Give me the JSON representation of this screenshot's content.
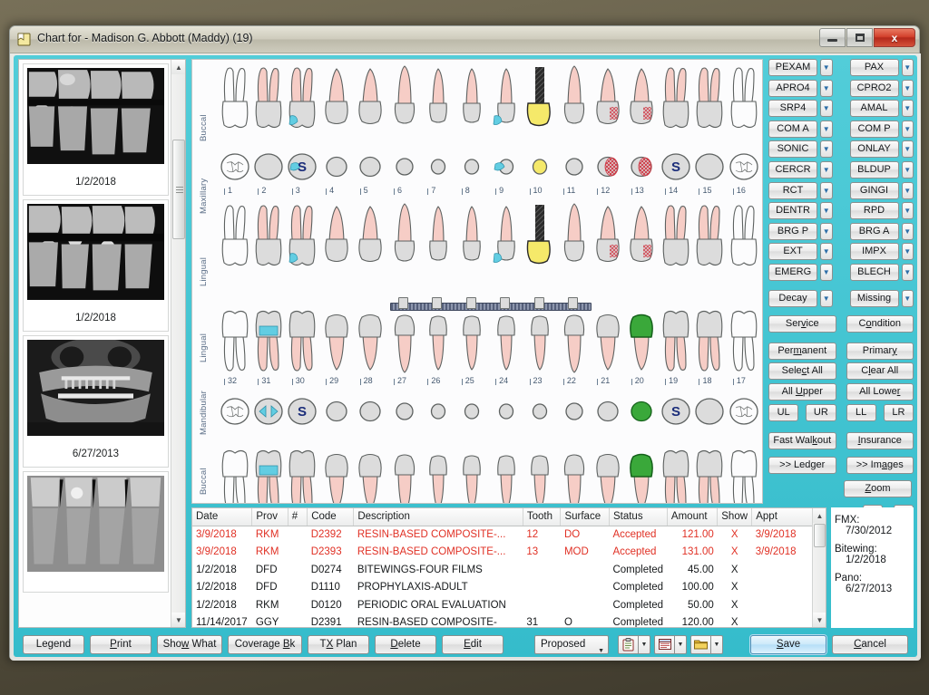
{
  "window": {
    "title": "Chart for - Madison G. Abbott (Maddy) (19)",
    "icon": "chart-book-icon",
    "minimize_label": "Minimize",
    "maximize_label": "Maximize",
    "close_label": "x"
  },
  "images_panel": {
    "thumbnails": [
      {
        "caption": "1/2/2018",
        "kind": "bitewing-xray"
      },
      {
        "caption": "1/2/2018",
        "kind": "bitewing-xray"
      },
      {
        "caption": "6/27/2013",
        "kind": "panoramic-xray"
      },
      {
        "caption": "",
        "kind": "periapical-xray"
      }
    ]
  },
  "chart": {
    "arch_labels": {
      "maxillary_buccal": "Buccal",
      "maxillary": "Maxillary",
      "maxillary_lingual": "Lingual",
      "mandibular_lingual": "Lingual",
      "mandibular": "Mandibular",
      "mandibular_buccal": "Buccal"
    },
    "upper_numbers": [
      "1",
      "2",
      "3",
      "4",
      "5",
      "6",
      "7",
      "8",
      "9",
      "10",
      "11",
      "12",
      "13",
      "14",
      "15",
      "16"
    ],
    "lower_numbers": [
      "32",
      "31",
      "30",
      "29",
      "28",
      "27",
      "26",
      "25",
      "24",
      "23",
      "22",
      "21",
      "20",
      "19",
      "18",
      "17"
    ],
    "upper_teeth": [
      {
        "num": "1",
        "type": "molar",
        "present": false,
        "root_color": "none",
        "marks": []
      },
      {
        "num": "2",
        "type": "molar",
        "present": true,
        "root_color": "pink",
        "marks": []
      },
      {
        "num": "3",
        "type": "molar",
        "present": true,
        "root_color": "pink",
        "marks": [
          "sealant",
          "watch-blue"
        ]
      },
      {
        "num": "4",
        "type": "premolar",
        "present": true,
        "root_color": "pink",
        "marks": []
      },
      {
        "num": "5",
        "type": "premolar",
        "present": true,
        "root_color": "pink",
        "marks": []
      },
      {
        "num": "6",
        "type": "canine",
        "present": true,
        "root_color": "pink",
        "marks": []
      },
      {
        "num": "7",
        "type": "incisor",
        "present": true,
        "root_color": "pink",
        "marks": []
      },
      {
        "num": "8",
        "type": "incisor",
        "present": true,
        "root_color": "pink",
        "marks": []
      },
      {
        "num": "9",
        "type": "incisor",
        "present": true,
        "root_color": "pink",
        "marks": [
          "watch-blue"
        ]
      },
      {
        "num": "10",
        "type": "incisor",
        "present": true,
        "root_color": "post",
        "marks": [
          "crown-gold",
          "post"
        ]
      },
      {
        "num": "11",
        "type": "canine",
        "present": true,
        "root_color": "pink",
        "marks": []
      },
      {
        "num": "12",
        "type": "premolar",
        "present": true,
        "root_color": "pink",
        "marks": [
          "decay-red"
        ]
      },
      {
        "num": "13",
        "type": "premolar",
        "present": true,
        "root_color": "pink",
        "marks": [
          "decay-red"
        ]
      },
      {
        "num": "14",
        "type": "molar",
        "present": true,
        "root_color": "pink",
        "marks": [
          "sealant"
        ]
      },
      {
        "num": "15",
        "type": "molar",
        "present": true,
        "root_color": "pink",
        "marks": []
      },
      {
        "num": "16",
        "type": "molar",
        "present": false,
        "root_color": "none",
        "marks": []
      }
    ],
    "lower_teeth": [
      {
        "num": "32",
        "type": "molar",
        "present": false,
        "root_color": "none",
        "marks": []
      },
      {
        "num": "31",
        "type": "molar",
        "present": true,
        "root_color": "pink",
        "marks": [
          "restoration-blue"
        ]
      },
      {
        "num": "30",
        "type": "molar",
        "present": true,
        "root_color": "pink",
        "marks": [
          "sealant"
        ]
      },
      {
        "num": "29",
        "type": "premolar",
        "present": true,
        "root_color": "pink",
        "marks": []
      },
      {
        "num": "28",
        "type": "premolar",
        "present": true,
        "root_color": "pink",
        "marks": []
      },
      {
        "num": "27",
        "type": "canine",
        "present": true,
        "root_color": "pink",
        "marks": [
          "splint"
        ]
      },
      {
        "num": "26",
        "type": "incisor",
        "present": true,
        "root_color": "pink",
        "marks": [
          "splint"
        ]
      },
      {
        "num": "25",
        "type": "incisor",
        "present": true,
        "root_color": "pink",
        "marks": [
          "splint"
        ]
      },
      {
        "num": "24",
        "type": "incisor",
        "present": true,
        "root_color": "pink",
        "marks": [
          "splint"
        ]
      },
      {
        "num": "23",
        "type": "incisor",
        "present": true,
        "root_color": "pink",
        "marks": [
          "splint"
        ]
      },
      {
        "num": "22",
        "type": "canine",
        "present": true,
        "root_color": "pink",
        "marks": [
          "splint"
        ]
      },
      {
        "num": "21",
        "type": "premolar",
        "present": true,
        "root_color": "pink",
        "marks": []
      },
      {
        "num": "20",
        "type": "premolar",
        "present": true,
        "root_color": "pink",
        "marks": [
          "crown-green"
        ]
      },
      {
        "num": "19",
        "type": "molar",
        "present": true,
        "root_color": "pink",
        "marks": [
          "sealant"
        ]
      },
      {
        "num": "18",
        "type": "molar",
        "present": true,
        "root_color": "pink",
        "marks": []
      },
      {
        "num": "17",
        "type": "molar",
        "present": false,
        "root_color": "none",
        "marks": []
      }
    ],
    "colors": {
      "root_pink": "#f6cdc6",
      "crown_gray": "#dcdcdc",
      "sealant_blue": "#1b2d7a",
      "watch_blue": "#62cde2",
      "decay_red": "#cf3a46",
      "crown_gold": "#f5e96a",
      "proposed_green": "#3aa83a",
      "number_blue": "#44586f"
    }
  },
  "procedure_buttons": {
    "left_column": [
      "PEXAM",
      "APRO4",
      "SRP4",
      "COM A",
      "SONIC",
      "CERCR",
      "RCT",
      "DENTR",
      "BRG P",
      "EXT",
      "EMERG"
    ],
    "right_column": [
      "PAX",
      "CPRO2",
      "AMAL",
      "COM P",
      "ONLAY",
      "BLDUP",
      "GINGI",
      "RPD",
      "BRG A",
      "IMPX",
      "BLECH"
    ],
    "condition_row": {
      "left": "Decay",
      "right": "Missing"
    },
    "mode_row": {
      "left": "Service",
      "right": "Condition"
    },
    "dentition_row": {
      "left": "Permanent",
      "right": "Primary"
    },
    "selection_row": {
      "left": "Select All",
      "right": "Clear All"
    },
    "arch_row": {
      "left": "All Upper",
      "right": "All Lower"
    },
    "quadrants": [
      "UL",
      "UR",
      "LL",
      "LR"
    ],
    "action_rows": [
      {
        "left": "Fast Walkout",
        "right": "Insurance"
      },
      {
        "left": ">> Ledger",
        "right": ">> Images"
      }
    ],
    "zoom_label": "Zoom",
    "icon_buttons": [
      "medical-alert-icon",
      "tooth-magnifier-icon"
    ]
  },
  "table": {
    "columns": [
      "Date",
      "Prov",
      "#",
      "Code",
      "Description",
      "Tooth",
      "Surface",
      "Status",
      "Amount",
      "Show",
      "Appt"
    ],
    "rows": [
      {
        "date": "3/9/2018",
        "prov": "RKM",
        "num": "",
        "code": "D2392",
        "desc": "RESIN-BASED COMPOSITE-...",
        "tooth": "12",
        "surface": "DO",
        "status": "Accepted",
        "amount": "121.00",
        "show": "X",
        "appt": "3/9/2018",
        "proposed": true
      },
      {
        "date": "3/9/2018",
        "prov": "RKM",
        "num": "",
        "code": "D2393",
        "desc": "RESIN-BASED COMPOSITE-...",
        "tooth": "13",
        "surface": "MOD",
        "status": "Accepted",
        "amount": "131.00",
        "show": "X",
        "appt": "3/9/2018",
        "proposed": true
      },
      {
        "date": "1/2/2018",
        "prov": "DFD",
        "num": "",
        "code": "D0274",
        "desc": "BITEWINGS-FOUR FILMS",
        "tooth": "",
        "surface": "",
        "status": "Completed",
        "amount": "45.00",
        "show": "X",
        "appt": "",
        "proposed": false
      },
      {
        "date": "1/2/2018",
        "prov": "DFD",
        "num": "",
        "code": "D1110",
        "desc": "PROPHYLAXIS-ADULT",
        "tooth": "",
        "surface": "",
        "status": "Completed",
        "amount": "100.00",
        "show": "X",
        "appt": "",
        "proposed": false
      },
      {
        "date": "1/2/2018",
        "prov": "RKM",
        "num": "",
        "code": "D0120",
        "desc": "PERIODIC ORAL EVALUATION",
        "tooth": "",
        "surface": "",
        "status": "Completed",
        "amount": "50.00",
        "show": "X",
        "appt": "",
        "proposed": false
      },
      {
        "date": "11/14/2017",
        "prov": "GGY",
        "num": "",
        "code": "D2391",
        "desc": "RESIN-BASED COMPOSITE-",
        "tooth": "31",
        "surface": "O",
        "status": "Completed",
        "amount": "120.00",
        "show": "X",
        "appt": "",
        "proposed": false
      }
    ]
  },
  "info": {
    "fmx_label": "FMX:",
    "fmx_date": "7/30/2012",
    "bitewing_label": "Bitewing:",
    "bitewing_date": "1/2/2018",
    "pano_label": "Pano:",
    "pano_date": "6/27/2013"
  },
  "toolbar": {
    "legend": "Legend",
    "print": "Print",
    "show_what": "Show What",
    "coverage_bk": "Coverage Bk",
    "tx_plan": "TX Plan",
    "delete": "Delete",
    "edit": "Edit",
    "status_select": "Proposed",
    "icon_buttons": [
      "clipboard-icon",
      "notes-icon",
      "folder-icon"
    ],
    "save": "Save",
    "cancel": "Cancel"
  }
}
